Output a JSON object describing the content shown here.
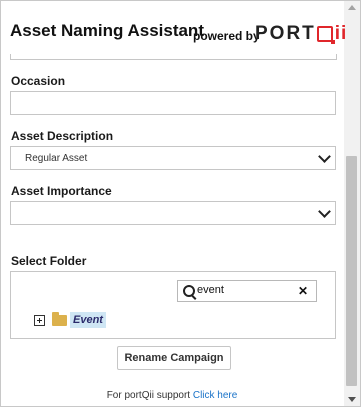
{
  "header": {
    "title": "Asset Naming Assistant",
    "powered_by": "powered by",
    "logo_text": "PORT",
    "logo_suffix": "ii"
  },
  "form": {
    "occasion": {
      "label": "Occasion",
      "value": ""
    },
    "asset_description": {
      "label": "Asset Description",
      "selected": "Regular Asset"
    },
    "asset_importance": {
      "label": "Asset Importance",
      "selected": ""
    },
    "select_folder": {
      "label": "Select Folder",
      "search_value": "event",
      "tree": [
        {
          "label": "Event",
          "expanded": false,
          "selected": true
        }
      ]
    }
  },
  "actions": {
    "rename_label": "Rename Campaign"
  },
  "footer": {
    "support_text": "For portQii support",
    "support_link": "Click here"
  },
  "colors": {
    "brand_red": "#e0262b",
    "link_blue": "#1a73c8",
    "folder_yellow": "#dcb14c",
    "selection_blue": "#cfe6f4"
  },
  "icons": [
    "search-icon",
    "clear-icon",
    "expand-icon",
    "folder-icon",
    "chevron-down-icon"
  ]
}
